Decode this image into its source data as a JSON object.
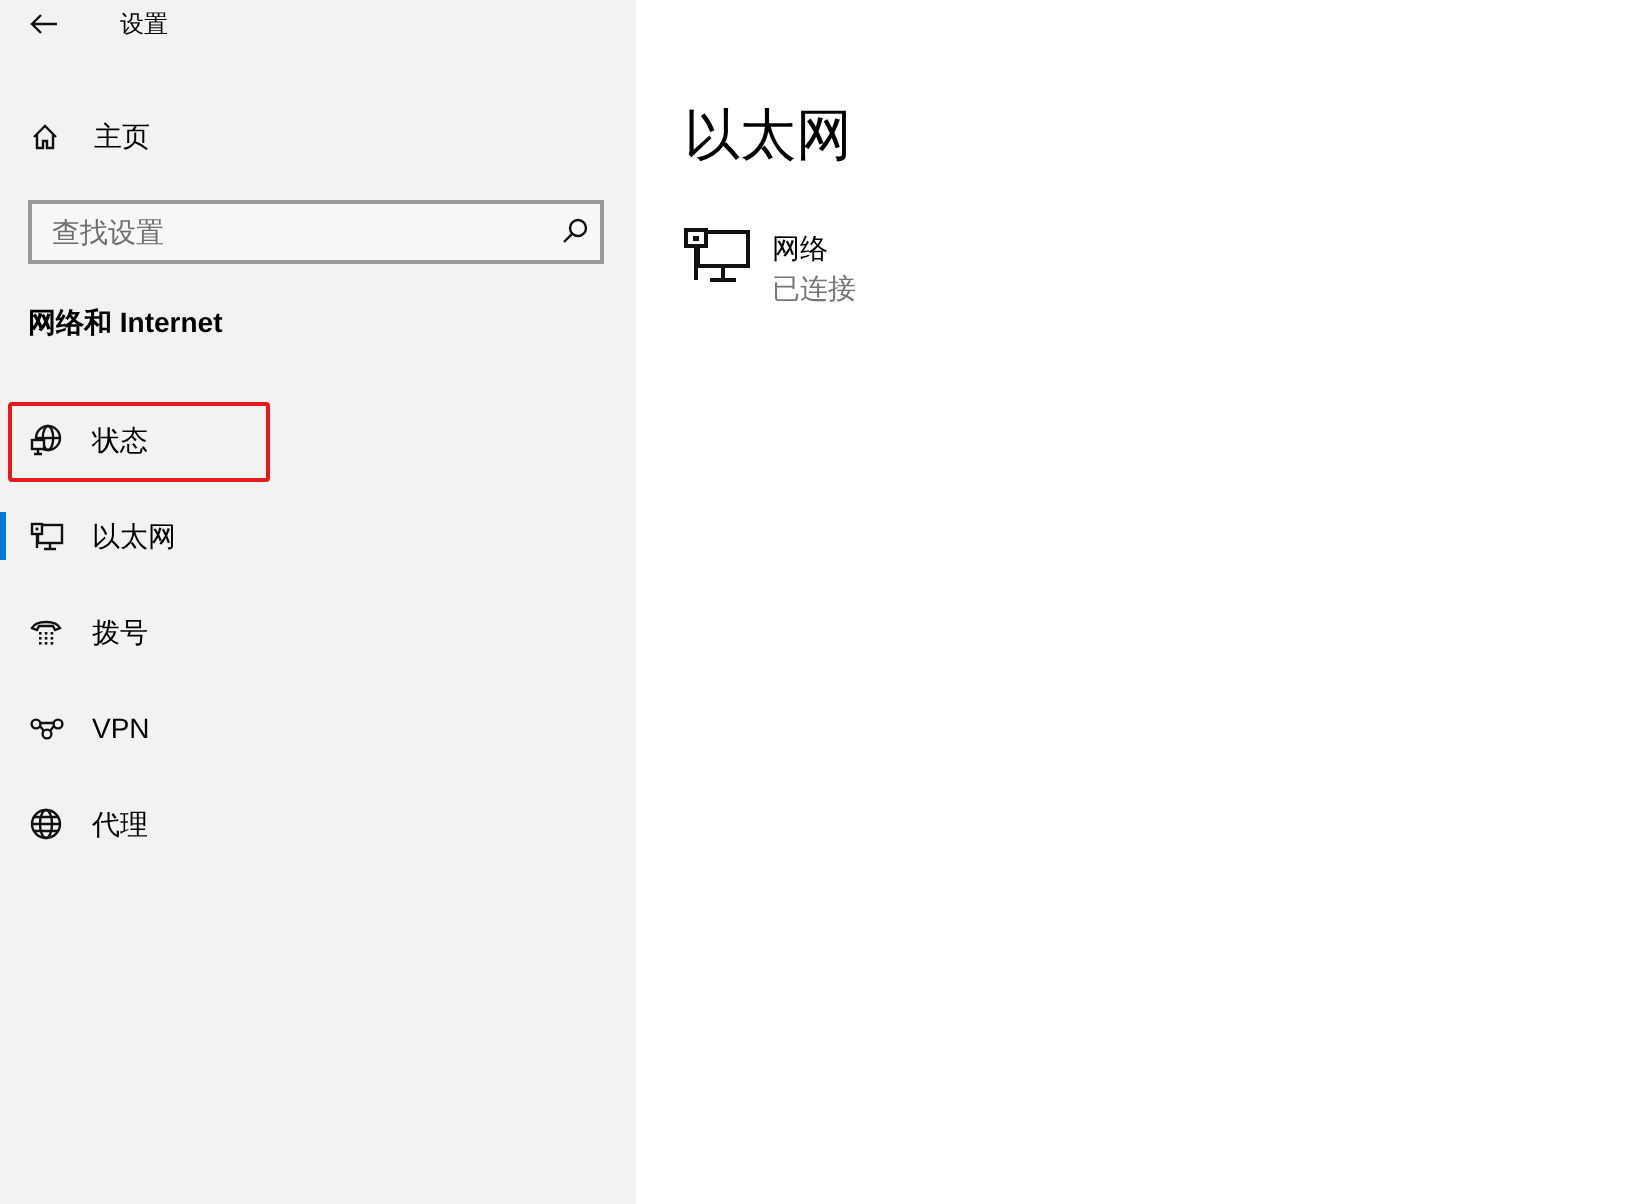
{
  "window": {
    "title": "设置"
  },
  "sidebar": {
    "home": {
      "label": "主页"
    },
    "search": {
      "placeholder": "查找设置"
    },
    "section_title": "网络和 Internet",
    "items": [
      {
        "label": "状态",
        "selected": false,
        "highlighted": true
      },
      {
        "label": "以太网",
        "selected": true,
        "highlighted": false
      },
      {
        "label": "拨号",
        "selected": false,
        "highlighted": false
      },
      {
        "label": "VPN",
        "selected": false,
        "highlighted": false
      },
      {
        "label": "代理",
        "selected": false,
        "highlighted": false
      }
    ]
  },
  "main": {
    "title": "以太网",
    "connections": [
      {
        "name": "网络",
        "status": "已连接"
      }
    ]
  }
}
